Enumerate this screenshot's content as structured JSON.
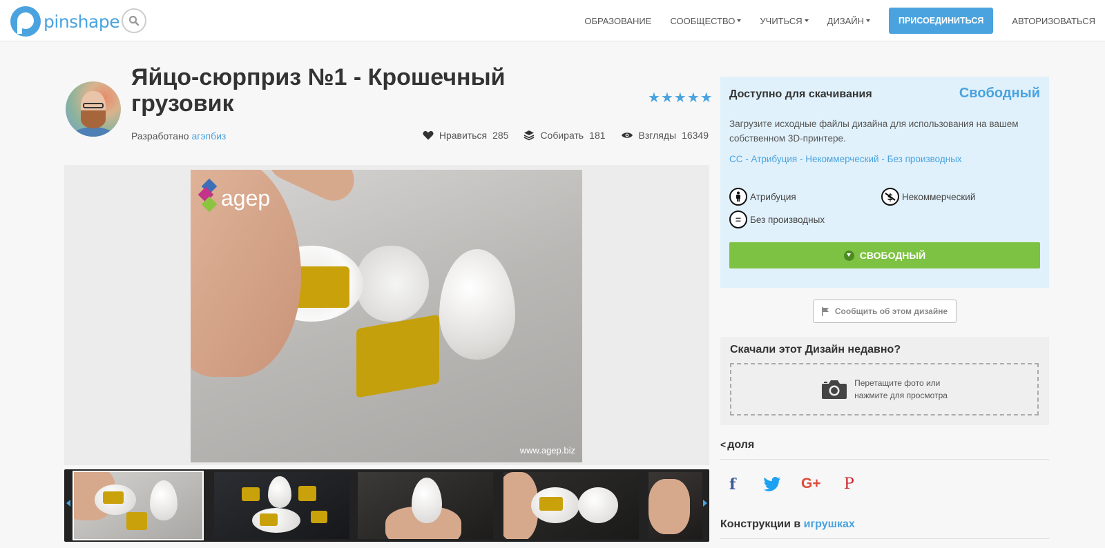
{
  "header": {
    "logo_text": "pinshape",
    "nav": [
      {
        "label": "ОБРАЗОВАНИЕ",
        "dropdown": false
      },
      {
        "label": "СООБЩЕСТВО",
        "dropdown": true
      },
      {
        "label": "УЧИТЬСЯ",
        "dropdown": true
      },
      {
        "label": "ДИЗАЙН",
        "dropdown": true
      }
    ],
    "join_label": "ПРИСОЕДИНИТЬСЯ",
    "login_label": "АВТОРИЗОВАТЬСЯ"
  },
  "design": {
    "title": "Яйцо-сюрприз №1 - Крошечный грузовик",
    "by_label": "Разработано",
    "designer": "агэпбиз",
    "rating_stars": 5,
    "stats": {
      "likes_label": "Нравиться",
      "likes": "285",
      "collect_label": "Собирать",
      "collects": "181",
      "views_label": "Взгляды",
      "views": "16349"
    }
  },
  "gallery": {
    "watermark_brand": "agep",
    "watermark_url": "www.agep.biz",
    "thumbnail_count": 5
  },
  "download": {
    "title": "Доступно для скачивания",
    "price": "Свободный",
    "description": "Загрузите исходные файлы дизайна для использования на вашем собственном 3D-принтере.",
    "license": "CC - Атрибуция - Некоммерческий - Без производных",
    "license_items": {
      "attribution": "Атрибуция",
      "noncommercial": "Некоммерческий",
      "noderivs": "Без производных"
    },
    "button_label": "СВОБОДНЫЙ"
  },
  "report_label": "Сообщить об этом дизайне",
  "recent": {
    "title": "Скачали этот Дизайн недавно?",
    "drop_line1": "Перетащите фото или",
    "drop_line2": "нажмите для просмотра"
  },
  "share": {
    "title": "доля"
  },
  "designs_in": {
    "prefix": "Конструкции в",
    "category": "игрушках"
  },
  "colors": {
    "accent": "#4aa3df",
    "download_green": "#7dc242",
    "download_bg": "#e0f1fb",
    "facebook": "#3b5998",
    "twitter": "#1da1f2",
    "googleplus": "#dd4b39",
    "pinterest": "#cb2027"
  }
}
